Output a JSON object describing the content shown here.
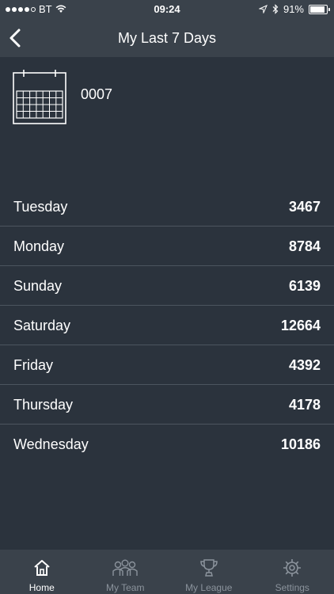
{
  "status": {
    "carrier": "BT",
    "time": "09:24",
    "battery": "91%",
    "battery_level": 0.91
  },
  "nav": {
    "title": "My Last 7 Days"
  },
  "header": {
    "id": "0007"
  },
  "days": [
    {
      "day": "Tuesday",
      "value": "3467"
    },
    {
      "day": "Monday",
      "value": "8784"
    },
    {
      "day": "Sunday",
      "value": "6139"
    },
    {
      "day": "Saturday",
      "value": "12664"
    },
    {
      "day": "Friday",
      "value": "4392"
    },
    {
      "day": "Thursday",
      "value": "4178"
    },
    {
      "day": "Wednesday",
      "value": "10186"
    }
  ],
  "tabs": [
    {
      "label": "Home",
      "icon": "home-icon",
      "active": true
    },
    {
      "label": "My Team",
      "icon": "team-icon",
      "active": false
    },
    {
      "label": "My League",
      "icon": "trophy-icon",
      "active": false
    },
    {
      "label": "Settings",
      "icon": "gear-icon",
      "active": false
    }
  ]
}
